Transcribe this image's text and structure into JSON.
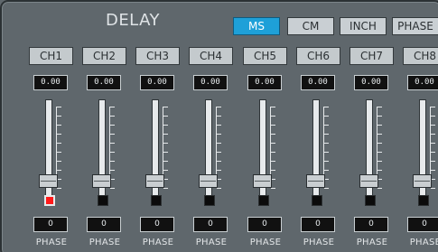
{
  "panel": {
    "title": "DELAY"
  },
  "modes": [
    {
      "label": "MS",
      "active": true
    },
    {
      "label": "CM",
      "active": false
    },
    {
      "label": "INCH",
      "active": false
    },
    {
      "label": "PHASE",
      "active": false
    }
  ],
  "channels": [
    {
      "label": "CH1",
      "delay": "0.00",
      "phase_value": "0",
      "phase_label": "PHASE",
      "phase_inverted": true
    },
    {
      "label": "CH2",
      "delay": "0.00",
      "phase_value": "0",
      "phase_label": "PHASE",
      "phase_inverted": false
    },
    {
      "label": "CH3",
      "delay": "0.00",
      "phase_value": "0",
      "phase_label": "PHASE",
      "phase_inverted": false
    },
    {
      "label": "CH4",
      "delay": "0.00",
      "phase_value": "0",
      "phase_label": "PHASE",
      "phase_inverted": false
    },
    {
      "label": "CH5",
      "delay": "0.00",
      "phase_value": "0",
      "phase_label": "PHASE",
      "phase_inverted": false
    },
    {
      "label": "CH6",
      "delay": "0.00",
      "phase_value": "0",
      "phase_label": "PHASE",
      "phase_inverted": false
    },
    {
      "label": "CH7",
      "delay": "0.00",
      "phase_value": "0",
      "phase_label": "PHASE",
      "phase_inverted": false
    },
    {
      "label": "CH8",
      "delay": "0.00",
      "phase_value": "0",
      "phase_label": "PHASE",
      "phase_inverted": false
    }
  ],
  "colors": {
    "background": "#5f676c",
    "active_mode": "#1ea0d8",
    "phase_on": "#ff1a1a",
    "phase_off": "#0b0b0b"
  },
  "fader_level": 0.0
}
